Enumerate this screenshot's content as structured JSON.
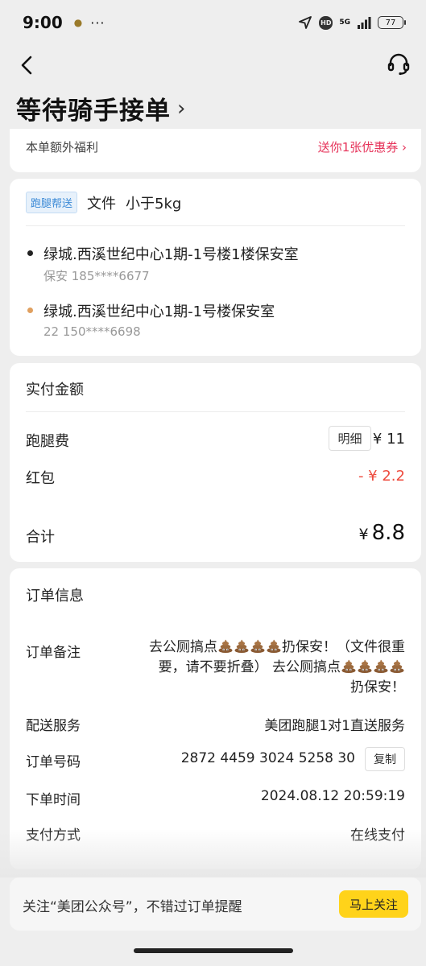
{
  "status_bar": {
    "time": "9:00",
    "more": "···",
    "network": "5G",
    "hd": "HD",
    "battery": "77"
  },
  "header": {
    "title": "等待骑手接单",
    "chevron": "›"
  },
  "promo": {
    "label": "本单额外福利",
    "link": "送你1张优惠券 ›"
  },
  "task": {
    "tag": "跑腿帮送",
    "type": "文件",
    "weight": "小于5kg",
    "pickup": {
      "address": "绿城.西溪世纪中心1期-1号楼1楼保安室",
      "contact": "保安 185****6677",
      "dot_color": "#222222"
    },
    "dropoff": {
      "address": "绿城.西溪世纪中心1期-1号楼保安室",
      "contact": "22 150****6698",
      "dot_color": "#e0a060"
    }
  },
  "payment": {
    "title": "实付金额",
    "errand_fee_label": "跑腿费",
    "detail_button": "明细",
    "errand_fee_value": "¥ 11",
    "redpacket_label": "红包",
    "redpacket_value": "- ¥ 2.2",
    "total_label": "合计",
    "total_currency": "¥",
    "total_value": "8.8"
  },
  "order": {
    "title": "订单信息",
    "note_label": "订单备注",
    "note_line1_a": "去公厕搞点",
    "note_line1_b": "扔保安！（文件很重",
    "note_line2_a": "要，请不要折叠） 去公厕搞点",
    "note_line3": "扔保安！",
    "delivery_label": "配送服务",
    "delivery_value": "美团跑腿1对1直送服务",
    "order_no_label": "订单号码",
    "order_no_value": "2872 4459 3024 5258 30",
    "copy_button": "复制",
    "time_label": "下单时间",
    "time_value": "2024.08.12 20:59:19",
    "pay_method_label": "支付方式",
    "pay_method_value": "在线支付"
  },
  "follow": {
    "text": "关注“美团公众号”，不错过订单提醒",
    "button": "马上关注"
  },
  "colors": {
    "accent_yellow": "#ffd31a",
    "promo_red": "#e6335a",
    "discount_red": "#ee4b3e",
    "tag_blue": "#3a89d6"
  }
}
